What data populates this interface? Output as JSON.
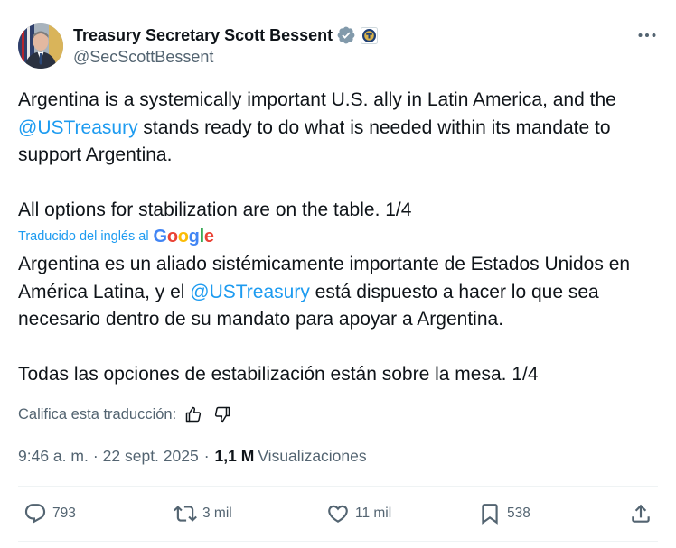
{
  "author": {
    "display_name": "Treasury Secretary Scott Bessent",
    "handle": "@SecScottBessent",
    "verified_badge_color": "#829aab",
    "affiliate_badge_icon": "treasury-seal-icon"
  },
  "tweet": {
    "p1_part1": "Argentina is a systemically important U.S. ally in Latin America, and the ",
    "p1_mention": "@USTreasury",
    "p1_part2": " stands ready to do what is needed within its mandate to support Argentina.",
    "p2": "All options for stabilization are on the table. 1/4"
  },
  "translation": {
    "label": "Traducido del inglés al",
    "provider": "Google",
    "p1_part1": "Argentina es un aliado sistémicamente importante de Estados Unidos en América Latina, y el ",
    "p1_mention": "@USTreasury",
    "p1_part2": " está dispuesto a hacer lo que sea necesario dentro de su mandato para apoyar a Argentina.",
    "p2": "Todas las opciones de estabilización están sobre la mesa. 1/4",
    "rate_label": "Califica esta traducción:"
  },
  "meta": {
    "time": "9:46 a. m.",
    "separator": "·",
    "date": "22 sept. 2025",
    "views_count": "1,1 M",
    "views_label": "Visualizaciones"
  },
  "actions": {
    "replies": "793",
    "reposts": "3 mil",
    "likes": "11 mil",
    "bookmarks": "538"
  },
  "colors": {
    "link": "#1d9bf0",
    "text": "#0f1419",
    "secondary": "#536471",
    "divider": "#eff3f4"
  }
}
